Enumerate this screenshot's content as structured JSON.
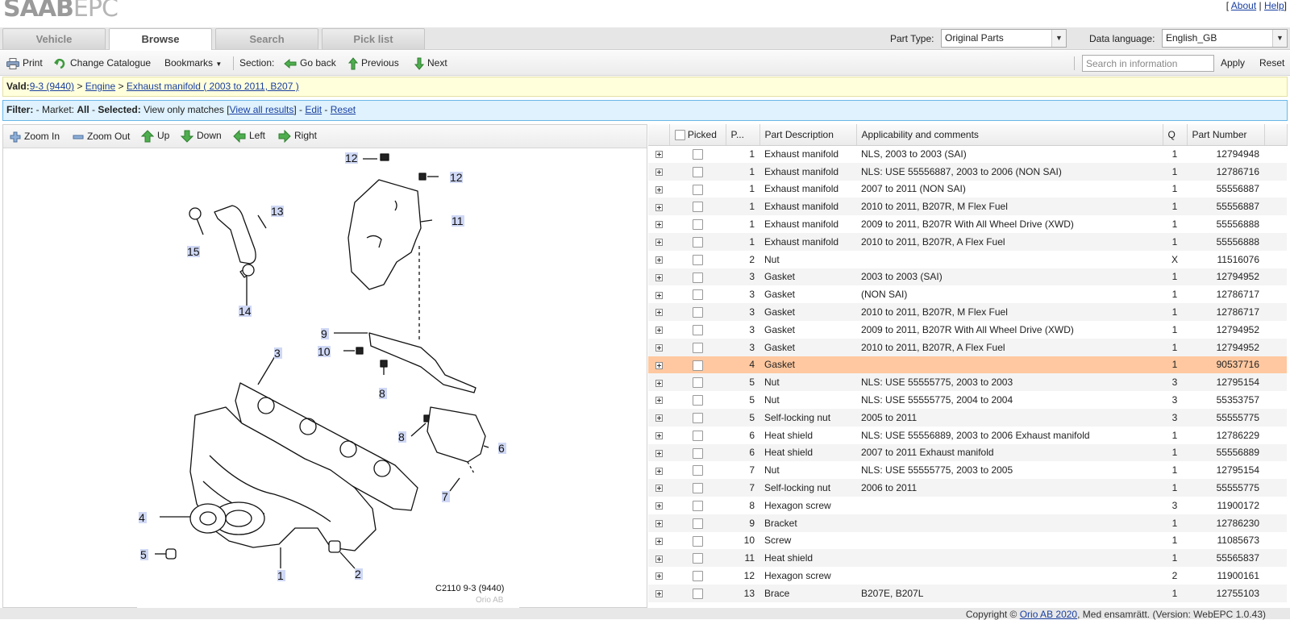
{
  "logo": {
    "bold": "SAAB",
    "light": "EPC"
  },
  "top_links": {
    "about": "About",
    "help": "Help",
    "sep": "|",
    "open": "[",
    "close": "]"
  },
  "tabs": [
    {
      "label": "Vehicle",
      "active": false
    },
    {
      "label": "Browse",
      "active": true
    },
    {
      "label": "Search",
      "active": false
    },
    {
      "label": "Pick list",
      "active": false
    }
  ],
  "part_type": {
    "label": "Part Type:",
    "value": "Original Parts"
  },
  "data_language": {
    "label": "Data language:",
    "value": "English_GB"
  },
  "toolbar": {
    "print": "Print",
    "change_catalogue": "Change Catalogue",
    "bookmarks": "Bookmarks",
    "section": "Section:",
    "go_back": "Go back",
    "previous": "Previous",
    "next": "Next",
    "search_placeholder": "Search in information",
    "apply": "Apply",
    "reset": "Reset"
  },
  "breadcrumb": {
    "prefix": "Vald:",
    "model": "9-3 (9440)",
    "sep": " > ",
    "group": "Engine",
    "section": "Exhaust manifold ( 2003 to 2011, B207 )"
  },
  "filter": {
    "label": "Filter:",
    "t1": " - Market: ",
    "market": "All",
    "t2": " - Selected: ",
    "selected": "View only matches [",
    "view_all": "View all results",
    "t3": "] - ",
    "edit": "Edit",
    "t4": " - ",
    "reset": "Reset"
  },
  "zoombar": {
    "zoom_in": "Zoom In",
    "zoom_out": "Zoom Out",
    "up": "Up",
    "down": "Down",
    "left": "Left",
    "right": "Right"
  },
  "diagram": {
    "caption": "C2110 9-3 (9440)",
    "watermark": "Orio AB",
    "callouts": [
      "12",
      "12",
      "13",
      "11",
      "15",
      "14",
      "9",
      "10",
      "3",
      "8",
      "8",
      "6",
      "7",
      "4",
      "5",
      "1",
      "2"
    ]
  },
  "parts_table": {
    "headers": {
      "picked": "Picked",
      "pos": "P...",
      "desc": "Part Description",
      "appl": "Applicability and comments",
      "q": "Q",
      "pn": "Part Number"
    },
    "rows": [
      {
        "pos": "1",
        "desc": "Exhaust manifold",
        "appl": "NLS, 2003 to 2003 (SAI)",
        "q": "1",
        "pn": "12794948"
      },
      {
        "pos": "1",
        "desc": "Exhaust manifold",
        "appl": "NLS: USE 55556887, 2003 to 2006 (NON SAI)",
        "q": "1",
        "pn": "12786716"
      },
      {
        "pos": "1",
        "desc": "Exhaust manifold",
        "appl": "2007 to 2011 (NON SAI)",
        "q": "1",
        "pn": "55556887"
      },
      {
        "pos": "1",
        "desc": "Exhaust manifold",
        "appl": "2010 to 2011, B207R, M Flex Fuel",
        "q": "1",
        "pn": "55556887"
      },
      {
        "pos": "1",
        "desc": "Exhaust manifold",
        "appl": "2009 to 2011, B207R With All Wheel Drive (XWD)",
        "q": "1",
        "pn": "55556888"
      },
      {
        "pos": "1",
        "desc": "Exhaust manifold",
        "appl": "2010 to 2011, B207R, A Flex Fuel",
        "q": "1",
        "pn": "55556888"
      },
      {
        "pos": "2",
        "desc": "Nut",
        "appl": "",
        "q": "X",
        "pn": "11516076"
      },
      {
        "pos": "3",
        "desc": "Gasket",
        "appl": "2003 to 2003 (SAI)",
        "q": "1",
        "pn": "12794952"
      },
      {
        "pos": "3",
        "desc": "Gasket",
        "appl": "(NON SAI)",
        "q": "1",
        "pn": "12786717"
      },
      {
        "pos": "3",
        "desc": "Gasket",
        "appl": "2010 to 2011, B207R, M Flex Fuel",
        "q": "1",
        "pn": "12786717"
      },
      {
        "pos": "3",
        "desc": "Gasket",
        "appl": "2009 to 2011, B207R With All Wheel Drive (XWD)",
        "q": "1",
        "pn": "12794952"
      },
      {
        "pos": "3",
        "desc": "Gasket",
        "appl": "2010 to 2011, B207R, A Flex Fuel",
        "q": "1",
        "pn": "12794952"
      },
      {
        "pos": "4",
        "desc": "Gasket",
        "appl": "",
        "q": "1",
        "pn": "90537716",
        "selected": true
      },
      {
        "pos": "5",
        "desc": "Nut",
        "appl": "NLS: USE 55555775, 2003 to 2003",
        "q": "3",
        "pn": "12795154"
      },
      {
        "pos": "5",
        "desc": "Nut",
        "appl": "NLS: USE 55555775, 2004 to 2004",
        "q": "3",
        "pn": "55353757"
      },
      {
        "pos": "5",
        "desc": "Self-locking nut",
        "appl": "2005 to 2011",
        "q": "3",
        "pn": "55555775"
      },
      {
        "pos": "6",
        "desc": "Heat shield",
        "appl": "NLS: USE 55556889, 2003 to 2006 Exhaust manifold",
        "q": "1",
        "pn": "12786229"
      },
      {
        "pos": "6",
        "desc": "Heat shield",
        "appl": "2007 to 2011 Exhaust manifold",
        "q": "1",
        "pn": "55556889"
      },
      {
        "pos": "7",
        "desc": "Nut",
        "appl": "NLS: USE 55555775, 2003 to 2005",
        "q": "1",
        "pn": "12795154"
      },
      {
        "pos": "7",
        "desc": "Self-locking nut",
        "appl": "2006 to 2011",
        "q": "1",
        "pn": "55555775"
      },
      {
        "pos": "8",
        "desc": "Hexagon screw",
        "appl": "",
        "q": "3",
        "pn": "11900172"
      },
      {
        "pos": "9",
        "desc": "Bracket",
        "appl": "",
        "q": "1",
        "pn": "12786230"
      },
      {
        "pos": "10",
        "desc": "Screw",
        "appl": "",
        "q": "1",
        "pn": "11085673"
      },
      {
        "pos": "11",
        "desc": "Heat shield",
        "appl": "",
        "q": "1",
        "pn": "55565837"
      },
      {
        "pos": "12",
        "desc": "Hexagon screw",
        "appl": "",
        "q": "2",
        "pn": "11900161"
      },
      {
        "pos": "13",
        "desc": "Brace",
        "appl": "B207E, B207L",
        "q": "1",
        "pn": "12755103"
      }
    ]
  },
  "footer": {
    "copyright": "Copyright © ",
    "company": "Orio AB 2020",
    "rest": ", Med ensamrätt. (Version: WebEPC 1.0.43)"
  },
  "colors": {
    "selected_row": "#ffc8a0",
    "breadcrumb_bg": "#ffffdc",
    "filter_bg": "#dff2fd",
    "link": "#1a3fa0"
  }
}
